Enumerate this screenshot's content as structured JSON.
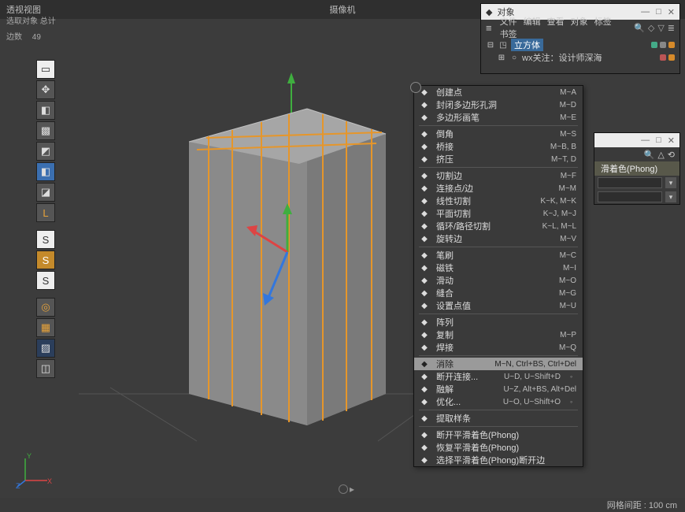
{
  "header": {
    "view_name_left": "透视视图",
    "view_name_center": "摄像机",
    "selection_summary": "选取对象 总计",
    "edge_label": "边数",
    "edge_count": "49"
  },
  "object_manager": {
    "window_title": "对象",
    "menu": [
      "文件",
      "编辑",
      "查看",
      "对象",
      "标签",
      "书签"
    ],
    "tree": [
      {
        "icon": "cube-icon",
        "label": "立方体",
        "selected": true,
        "dots": [
          "green",
          "grey",
          "orangeD"
        ]
      },
      {
        "icon": "null-icon",
        "label": "wx关注：设计师深海",
        "selected": false,
        "dots": [
          "red",
          "orangeD"
        ]
      }
    ]
  },
  "attr_panel": {
    "tab_label": "滑着色(Phong)"
  },
  "context_menu": {
    "items": [
      {
        "type": "item",
        "icon": "dot",
        "label": "创建点",
        "shortcut": "M~A"
      },
      {
        "type": "item",
        "icon": "poly",
        "label": "封闭多边形孔洞",
        "shortcut": "M~D"
      },
      {
        "type": "item",
        "icon": "brush",
        "label": "多边形画笔",
        "shortcut": "M~E"
      },
      {
        "type": "sep"
      },
      {
        "type": "item",
        "icon": "bevel",
        "label": "倒角",
        "shortcut": "M~S"
      },
      {
        "type": "item",
        "icon": "bridge",
        "label": "桥接",
        "shortcut": "M~B, B"
      },
      {
        "type": "item",
        "icon": "extrude",
        "label": "挤压",
        "shortcut": "M~T, D"
      },
      {
        "type": "sep"
      },
      {
        "type": "item",
        "icon": "knife",
        "label": "切割边",
        "shortcut": "M~F"
      },
      {
        "type": "item",
        "icon": "connect",
        "label": "连接点/边",
        "shortcut": "M~M"
      },
      {
        "type": "item",
        "icon": "line",
        "label": "线性切割",
        "shortcut": "K~K, M~K"
      },
      {
        "type": "item",
        "icon": "plane",
        "label": "平面切割",
        "shortcut": "K~J, M~J"
      },
      {
        "type": "item",
        "icon": "loop",
        "label": "循环/路径切割",
        "shortcut": "K~L, M~L"
      },
      {
        "type": "item",
        "icon": "spin",
        "label": "旋转边",
        "shortcut": "M~V"
      },
      {
        "type": "sep"
      },
      {
        "type": "item",
        "icon": "brush2",
        "label": "笔刷",
        "shortcut": "M~C"
      },
      {
        "type": "item",
        "icon": "magnet",
        "label": "磁铁",
        "shortcut": "M~I"
      },
      {
        "type": "item",
        "icon": "slide",
        "label": "滑动",
        "shortcut": "M~O"
      },
      {
        "type": "item",
        "icon": "smooth",
        "label": "缝合",
        "shortcut": "M~G"
      },
      {
        "type": "item",
        "icon": "setpt",
        "label": "设置点值",
        "shortcut": "M~U"
      },
      {
        "type": "sep"
      },
      {
        "type": "item",
        "icon": "array",
        "label": "阵列",
        "shortcut": ""
      },
      {
        "type": "item",
        "icon": "clone",
        "label": "复制",
        "shortcut": "M~P"
      },
      {
        "type": "item",
        "icon": "weld",
        "label": "焊接",
        "shortcut": "M~Q"
      },
      {
        "type": "sep"
      },
      {
        "type": "item",
        "icon": "del",
        "label": "消除",
        "shortcut": "M~N, Ctrl+BS, Ctrl+Del",
        "hl": true
      },
      {
        "type": "item",
        "icon": "disc",
        "label": "断开连接...",
        "shortcut": "U~D, U~Shift+D",
        "sub": true
      },
      {
        "type": "item",
        "icon": "melt",
        "label": "融解",
        "shortcut": "U~Z, Alt+BS, Alt+Del"
      },
      {
        "type": "item",
        "icon": "opt",
        "label": "优化...",
        "shortcut": "U~O, U~Shift+O",
        "sub": true
      },
      {
        "type": "sep"
      },
      {
        "type": "item",
        "icon": "spl",
        "label": "提取样条",
        "shortcut": ""
      },
      {
        "type": "sep"
      },
      {
        "type": "item",
        "icon": "phong",
        "label": "断开平滑着色(Phong)",
        "shortcut": ""
      },
      {
        "type": "item",
        "icon": "phong",
        "label": "恢复平滑着色(Phong)",
        "shortcut": ""
      },
      {
        "type": "item",
        "icon": "phong",
        "label": "选择平滑着色(Phong)断开边",
        "shortcut": ""
      }
    ]
  },
  "status": {
    "grid_label": "网格间距 : 100 cm"
  },
  "tools": {
    "list": [
      {
        "name": "live-selection-tool",
        "cls": "white",
        "glyph": "▭"
      },
      {
        "name": "move-tool",
        "glyph": "✥"
      },
      {
        "name": "cube-tool",
        "glyph": "◧"
      },
      {
        "name": "checker-tool",
        "glyph": "▩"
      },
      {
        "name": "obj-tool",
        "glyph": "◩"
      },
      {
        "name": "sel-tool",
        "cls": "lsel",
        "glyph": "◧"
      },
      {
        "name": "compound-tool",
        "glyph": "◪"
      },
      {
        "name": "l-tool",
        "cls": "orange",
        "glyph": "L"
      },
      {
        "name": "gap",
        "cls": "gap",
        "glyph": ""
      },
      {
        "name": "s1-tool",
        "cls": "white",
        "glyph": "S"
      },
      {
        "name": "s2-tool",
        "cls": "gold",
        "glyph": "S"
      },
      {
        "name": "s3-tool",
        "cls": "white",
        "glyph": "S"
      },
      {
        "name": "gap",
        "cls": "gap",
        "glyph": ""
      },
      {
        "name": "ring-tool",
        "cls": "orange",
        "glyph": "◎"
      },
      {
        "name": "grid-tool",
        "cls": "orange",
        "glyph": "▦"
      },
      {
        "name": "diag-tool",
        "cls": "dblue",
        "glyph": "▨"
      },
      {
        "name": "cam-tool",
        "glyph": "◫"
      }
    ]
  }
}
